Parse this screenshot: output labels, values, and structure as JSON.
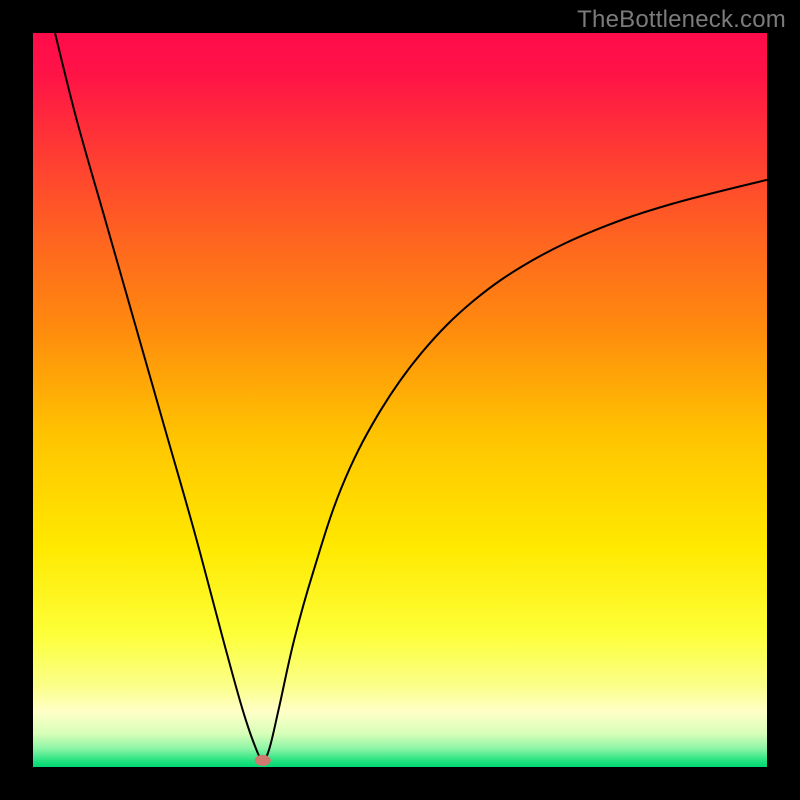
{
  "watermark": "TheBottleneck.com",
  "chart_data": {
    "type": "line",
    "title": "",
    "xlabel": "",
    "ylabel": "",
    "xlim": [
      0,
      100
    ],
    "ylim": [
      0,
      100
    ],
    "background_gradient": {
      "stops": [
        {
          "pos": 0.0,
          "color": "#ff0b4a"
        },
        {
          "pos": 0.06,
          "color": "#ff1446"
        },
        {
          "pos": 0.16,
          "color": "#ff3a34"
        },
        {
          "pos": 0.28,
          "color": "#ff6420"
        },
        {
          "pos": 0.4,
          "color": "#ff8a0e"
        },
        {
          "pos": 0.55,
          "color": "#ffc400"
        },
        {
          "pos": 0.7,
          "color": "#ffe900"
        },
        {
          "pos": 0.82,
          "color": "#fdff39"
        },
        {
          "pos": 0.89,
          "color": "#fbff8a"
        },
        {
          "pos": 0.925,
          "color": "#ffffc8"
        },
        {
          "pos": 0.955,
          "color": "#d6ffb8"
        },
        {
          "pos": 0.975,
          "color": "#8cf5a6"
        },
        {
          "pos": 0.992,
          "color": "#20e27e"
        },
        {
          "pos": 1.0,
          "color": "#00d873"
        }
      ]
    },
    "series": [
      {
        "name": "bottleneck-curve",
        "color": "#000000",
        "x": [
          3.0,
          6.0,
          10.0,
          14.0,
          18.0,
          22.0,
          26.0,
          28.5,
          30.3,
          31.3,
          32.2,
          33.5,
          35.5,
          38.0,
          42.0,
          47.0,
          53.0,
          60.0,
          68.0,
          77.0,
          87.0,
          100.0
        ],
        "y": [
          100.0,
          88.0,
          74.0,
          60.0,
          46.0,
          32.0,
          17.0,
          8.0,
          2.7,
          1.0,
          2.5,
          8.0,
          17.0,
          26.0,
          38.0,
          48.0,
          56.5,
          63.5,
          69.0,
          73.3,
          76.7,
          80.0
        ]
      }
    ],
    "marker": {
      "name": "optimal-point",
      "x": 31.3,
      "y": 0.9,
      "color": "#d07a6f",
      "rx": 1.1,
      "ry": 0.75
    }
  }
}
